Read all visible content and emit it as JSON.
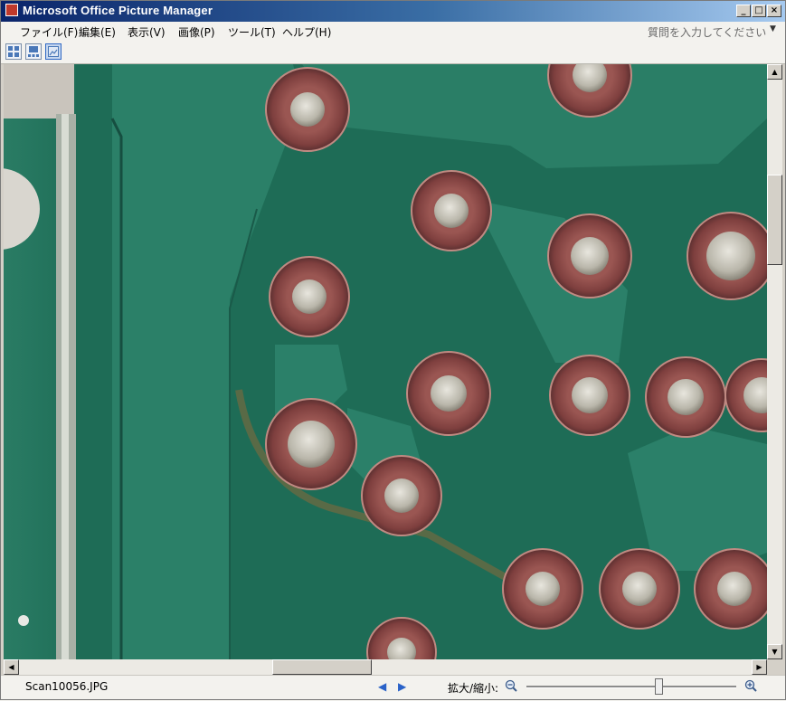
{
  "window": {
    "title": "Microsoft Office Picture Manager",
    "minimize_glyph": "_",
    "maximize_glyph": "□",
    "close_glyph": "×"
  },
  "menu": {
    "items": [
      "ファイル(F)",
      "編集(E)",
      "表示(V)",
      "画像(P)",
      "ツール(T)",
      "ヘルプ(H)"
    ],
    "help_placeholder": "質問を入力してください",
    "help_arrow": "▼"
  },
  "toolbar": {
    "buttons": [
      "thumbnail-view-icon",
      "filmstrip-view-icon",
      "single-picture-view-icon"
    ],
    "active_index": 2
  },
  "image": {
    "subject": "circuit-board-macro",
    "board_color": "#1c6b55",
    "pad_color": "#8a4a48"
  },
  "status": {
    "filename": "Scan10056.JPG",
    "prev_arrow": "◀",
    "next_arrow": "▶",
    "zoom_label": "拡大/縮小:",
    "zoom_level": 0.63
  },
  "scroll": {
    "vertical_position": 0.2,
    "horizontal_position": 0.4
  }
}
